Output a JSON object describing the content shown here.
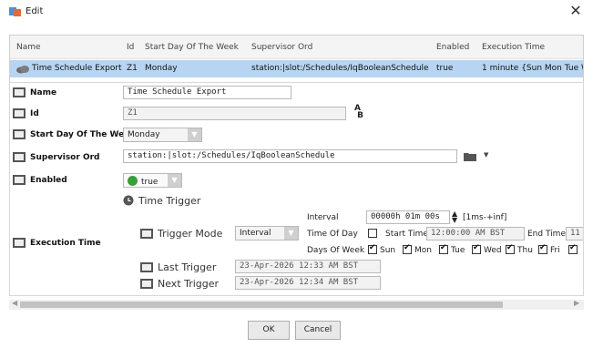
{
  "window": {
    "title": "Edit",
    "close_glyph": "✕"
  },
  "table": {
    "columns": [
      "Name",
      "Id",
      "Start Day Of The Week",
      "Supervisor Ord",
      "Enabled",
      "Execution Time"
    ],
    "row": {
      "name": "Time Schedule Export",
      "id": "Z1",
      "start_day": "Monday",
      "supervisor_ord": "station:|slot:/Schedules/IqBooleanSchedule",
      "enabled": "true",
      "execution_time": "1 minute {Sun Mon Tue W"
    }
  },
  "props": {
    "name": {
      "label": "Name",
      "value": "Time Schedule Export"
    },
    "id": {
      "label": "Id",
      "value": "Z1",
      "icon": "rename-icon"
    },
    "start_day": {
      "label": "Start Day Of The Week",
      "value": "Monday"
    },
    "supervisor_ord": {
      "label": "Supervisor Ord",
      "value": "station:|slot:/Schedules/IqBooleanSchedule",
      "icon": "folder-icon"
    },
    "enabled": {
      "label": "Enabled",
      "value": "true",
      "status_color": "#3a9e3a"
    },
    "execution_time": {
      "label": "Execution Time",
      "trigger_header": "Time Trigger",
      "trigger_mode_label": "Trigger Mode",
      "trigger_mode_value": "Interval",
      "interval_label": "Interval",
      "interval_value": "00000h 01m 00s",
      "interval_range": "[1ms-+inf]",
      "time_of_day_label": "Time Of Day",
      "start_time_label": "Start Time",
      "start_time_value": "12:00:00 AM BST",
      "end_time_label": "End Time",
      "end_time_value": "11",
      "days_label": "Days Of Week",
      "days": [
        "Sun",
        "Mon",
        "Tue",
        "Wed",
        "Thu",
        "Fri"
      ],
      "last_trigger_label": "Last Trigger",
      "last_trigger_value": "23-Apr-2026 12:33 AM BST",
      "next_trigger_label": "Next Trigger",
      "next_trigger_value": "23-Apr-2026 12:34 AM BST"
    }
  },
  "buttons": {
    "ok": "OK",
    "cancel": "Cancel"
  },
  "colors": {
    "selection": "#b7d5f2",
    "accent": "#3a9e3a"
  }
}
